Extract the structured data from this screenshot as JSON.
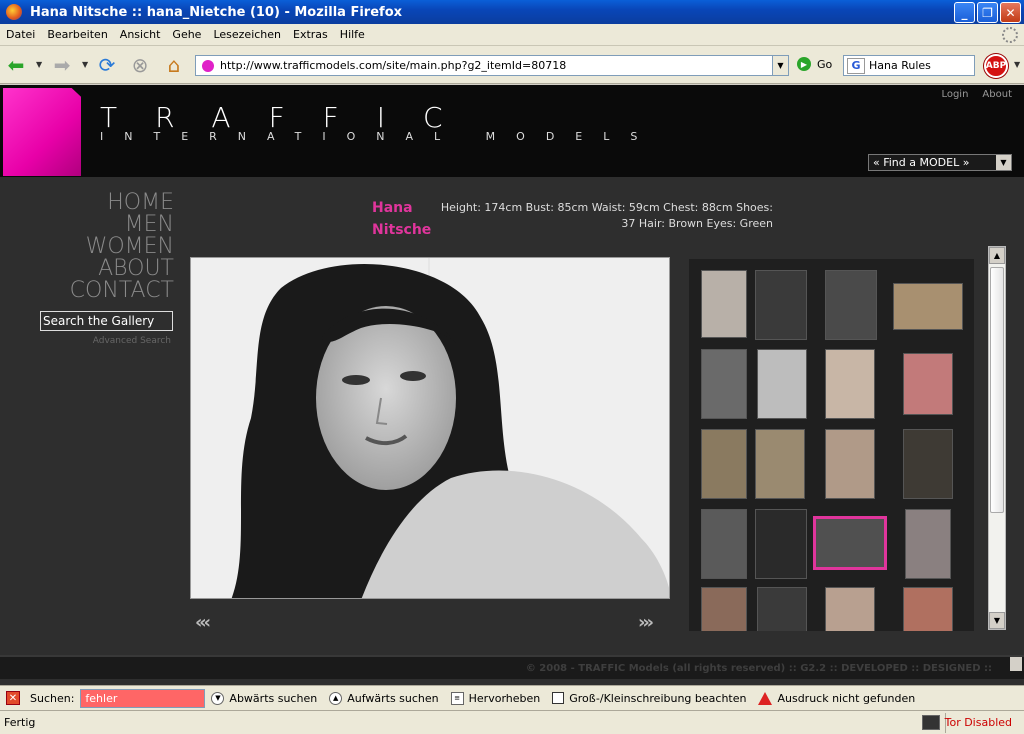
{
  "window": {
    "title": "Hana Nitsche :: hana_Nietche (10) - Mozilla Firefox"
  },
  "menu": [
    "Datei",
    "Bearbeiten",
    "Ansicht",
    "Gehe",
    "Lesezeichen",
    "Extras",
    "Hilfe"
  ],
  "toolbar": {
    "url": "http://www.trafficmodels.com/site/main.php?g2_itemId=80718",
    "go_label": "Go",
    "search_value": "Hana Rules",
    "abp_label": "ABP"
  },
  "site": {
    "logo_main": "TRAFFIC",
    "logo_sub": "INTERNATIONAL MODELS",
    "top_links": [
      "Login",
      "About"
    ],
    "find_model": "« Find a MODEL »",
    "nav": [
      "HOME",
      "MEN",
      "WOMEN",
      "ABOUT",
      "CONTACT"
    ],
    "search_gallery": "Search the Gallery",
    "advanced_search": "Advanced Search",
    "model_first": "Hana",
    "model_last": "Nitsche",
    "stats_line1": "Height: 174cm Bust: 85cm Waist: 59cm Chest: 88cm Shoes:",
    "stats_line2": "37 Hair: Brown Eyes: Green",
    "prev": "«‹",
    "next": "›»",
    "footer": "© 2008 - TRAFFIC Models (all rights reserved) :: G2.2 :: DEVELOPED :: DESIGNED ::"
  },
  "findbar": {
    "label": "Suchen:",
    "value": "fehler",
    "down": "Abwärts suchen",
    "up": "Aufwärts suchen",
    "highlight": "Hervorheben",
    "matchcase": "Groß-/Kleinschreibung beachten",
    "status": "Ausdruck nicht gefunden"
  },
  "statusbar": {
    "text": "Fertig",
    "tor": "Tor Disabled"
  }
}
